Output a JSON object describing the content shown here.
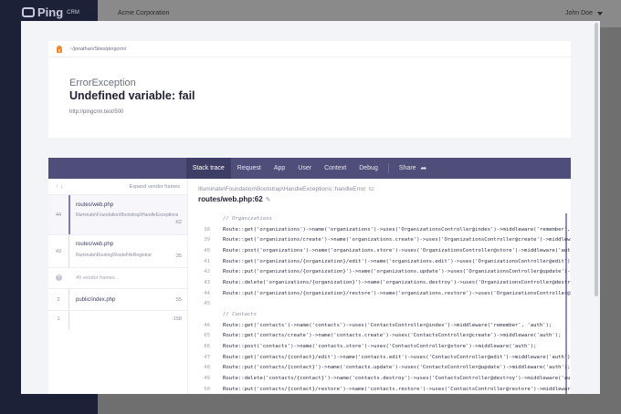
{
  "background": {
    "brand": "Ping",
    "brand_suffix": "CRM",
    "organization": "Acme Corporation",
    "user": "John Doe"
  },
  "error": {
    "path": "~/jonathan/Sites/pingcrm/",
    "exception_class": "ErrorException",
    "message": "Undefined variable: fail",
    "url": "http://pingcrm.test/500"
  },
  "tabs": {
    "stack_trace": "Stack trace",
    "request": "Request",
    "app": "App",
    "user": "User",
    "context": "Context",
    "debug": "Debug",
    "share": "Share"
  },
  "frames": {
    "expand_label": "Expand vendor frames",
    "items": [
      {
        "num": "44",
        "file": "routes/web.php",
        "class": "Illuminate\\Foundation\\Bootstrap\\HandleExceptions",
        "line": ":62"
      },
      {
        "num": "43",
        "file": "routes/web.php",
        "class": "Illuminate\\Routing\\RouteFileRegistrar",
        "line": ":35"
      },
      {
        "num": "",
        "file": "40 vendor frames...",
        "class": "",
        "line": ""
      },
      {
        "num": "2",
        "file": "public/index.php",
        "class": "",
        "line": ":55"
      },
      {
        "num": "1",
        "file": "",
        "class": "",
        "line": ":158"
      }
    ]
  },
  "code": {
    "namespace": "Illuminate\\Foundation\\Bootstrap\\HandleExceptions::handleError",
    "ns_line": "62",
    "file": "routes/web.php:62",
    "lines": [
      {
        "n": "",
        "src": "// Organizations",
        "type": "comment"
      },
      {
        "n": "38",
        "src": "Route::get('organizations')->name('organizations')->uses('OrganizationsController@index')->middleware('remember', 'auth');",
        "type": "code"
      },
      {
        "n": "39",
        "src": "Route::get('organizations/create')->name('organizations.create')->uses('OrganizationsController@create')->middleware('auth');",
        "type": "code"
      },
      {
        "n": "40",
        "src": "Route::post('organizations')->name('organizations.store')->uses('OrganizationsController@store')->middleware('auth');",
        "type": "code"
      },
      {
        "n": "41",
        "src": "Route::get('organizations/{organization}/edit')->name('organizations.edit')->uses('OrganizationsController@edit')->middleware('auth');",
        "type": "code"
      },
      {
        "n": "42",
        "src": "Route::put('organizations/{organization}')->name('organizations.update')->uses('OrganizationsController@update')->middleware('auth');",
        "type": "code"
      },
      {
        "n": "43",
        "src": "Route::delete('organizations/{organization}')->name('organizations.destroy')->uses('OrganizationsController@destroy')->middleware('auth');",
        "type": "code"
      },
      {
        "n": "44",
        "src": "Route::put('organizations/{organization}/restore')->name('organizations.restore')->uses('OrganizationsController@restore')->middleware('auth');",
        "type": "code"
      },
      {
        "n": "45",
        "src": "",
        "type": "blank"
      },
      {
        "n": "",
        "src": "// Contacts",
        "type": "comment"
      },
      {
        "n": "46",
        "src": "Route::get('contacts')->name('contacts')->uses('ContactsController@index')->middleware('remember', 'auth');",
        "type": "code"
      },
      {
        "n": "65",
        "src": "Route::get('contacts/create')->name('contacts.create')->uses('ContactsController@create')->middleware('auth');",
        "type": "code"
      },
      {
        "n": "66",
        "src": "Route::post('contacts')->name('contacts.store')->uses('ContactsController@store')->middleware('auth');",
        "type": "code"
      },
      {
        "n": "47",
        "src": "Route::get('contacts/{contact}/edit')->name('contacts.edit')->uses('ContactsController@edit')->middleware('auth');",
        "type": "code"
      },
      {
        "n": "48",
        "src": "Route::put('contacts/{contact}')->name('contacts.update')->uses('ContactsController@update')->middleware('auth');",
        "type": "code"
      },
      {
        "n": "49",
        "src": "Route::delete('contacts/{contact}')->name('contacts.destroy')->uses('ContactsController@destroy')->middleware('auth');",
        "type": "code"
      },
      {
        "n": "50",
        "src": "Route::put('contacts/{contact}/restore')->name('contacts.restore')->uses('ContactsController@restore')->middleware('auth');",
        "type": "code"
      }
    ]
  }
}
